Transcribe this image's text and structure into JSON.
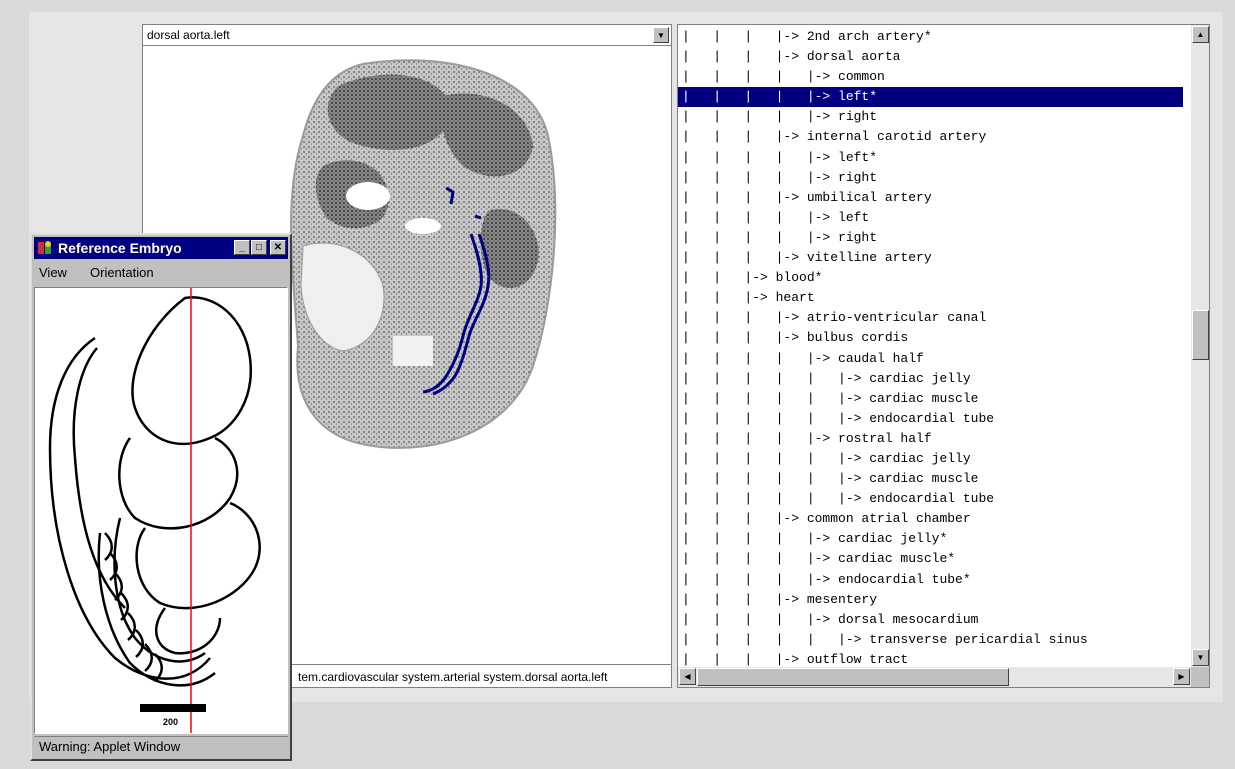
{
  "viewer": {
    "selected_structure": "dorsal aorta.left",
    "full_path_text": "tem.cardiovascular system.arterial system.dorsal aorta.left"
  },
  "tree": {
    "lines": [
      "|   |   |   |-> 2nd arch artery*",
      "|   |   |   |-> dorsal aorta",
      "|   |   |   |   |-> common",
      "|   |   |   |   |-> left*",
      "|   |   |   |   |-> right",
      "|   |   |   |-> internal carotid artery",
      "|   |   |   |   |-> left*",
      "|   |   |   |   |-> right",
      "|   |   |   |-> umbilical artery",
      "|   |   |   |   |-> left",
      "|   |   |   |   |-> right",
      "|   |   |   |-> vitelline artery",
      "|   |   |-> blood*",
      "|   |   |-> heart",
      "|   |   |   |-> atrio-ventricular canal",
      "|   |   |   |-> bulbus cordis",
      "|   |   |   |   |-> caudal half",
      "|   |   |   |   |   |-> cardiac jelly",
      "|   |   |   |   |   |-> cardiac muscle",
      "|   |   |   |   |   |-> endocardial tube",
      "|   |   |   |   |-> rostral half",
      "|   |   |   |   |   |-> cardiac jelly",
      "|   |   |   |   |   |-> cardiac muscle",
      "|   |   |   |   |   |-> endocardial tube",
      "|   |   |   |-> common atrial chamber",
      "|   |   |   |   |-> cardiac jelly*",
      "|   |   |   |   |-> cardiac muscle*",
      "|   |   |   |   |-> endocardial tube*",
      "|   |   |   |-> mesentery",
      "|   |   |   |   |-> dorsal mesocardium",
      "|   |   |   |   |   |-> transverse pericardial sinus",
      "|   |   |   |-> outflow tract"
    ],
    "selected_index": 3,
    "selection_color": "#000080",
    "vscroll_position": 0.48
  },
  "reference_window": {
    "title": "Reference Embryo",
    "menu": [
      "View",
      "Orientation"
    ],
    "scale_label": "200",
    "warning": "Warning: Applet Window",
    "section_line_color": "#ff0000"
  },
  "icons": {
    "minimize": "minimize-icon",
    "maximize": "maximize-icon",
    "close": "close-icon",
    "dropdown": "chevron-down-icon"
  }
}
